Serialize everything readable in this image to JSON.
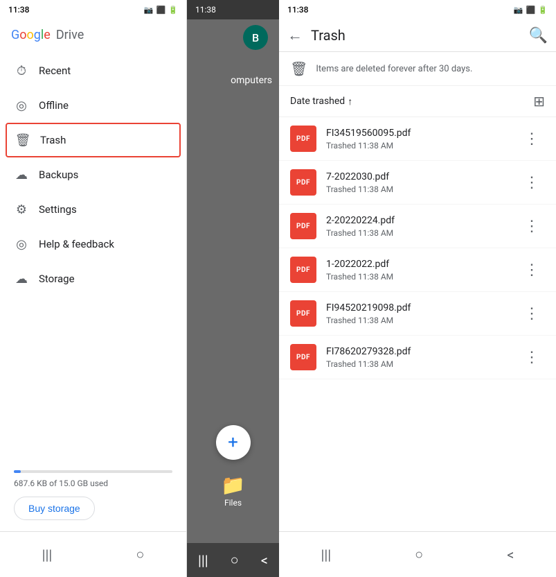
{
  "leftPanel": {
    "statusBar": {
      "time": "11:38"
    },
    "logo": {
      "google": "Google",
      "drive": "Drive"
    },
    "navItems": [
      {
        "id": "recent",
        "icon": "🕐",
        "label": "Recent",
        "active": false
      },
      {
        "id": "offline",
        "icon": "⊙",
        "label": "Offline",
        "active": false
      },
      {
        "id": "trash",
        "icon": "🗑",
        "label": "Trash",
        "active": true
      },
      {
        "id": "backups",
        "icon": "☁",
        "label": "Backups",
        "active": false
      },
      {
        "id": "settings",
        "icon": "⚙",
        "label": "Settings",
        "active": false
      },
      {
        "id": "help",
        "icon": "◎",
        "label": "Help & feedback",
        "active": false
      },
      {
        "id": "storage",
        "icon": "☁",
        "label": "Storage",
        "active": false
      }
    ],
    "storage": {
      "used": "687.6 KB of 15.0 GB used",
      "percentUsed": 4.58,
      "buyLabel": "Buy storage"
    },
    "bottomNav": [
      "|||",
      "○"
    ]
  },
  "middlePanel": {
    "statusBar": {
      "time": "11:38"
    },
    "avatar": "B",
    "label": "omputers",
    "fabPlus": "+",
    "filesLabel": "Files",
    "bottomNav": [
      "|||",
      "○",
      "<"
    ]
  },
  "rightPanel": {
    "statusBar": {
      "time": "11:38"
    },
    "header": {
      "title": "Trash",
      "backArrow": "←",
      "searchIcon": "🔍"
    },
    "notice": {
      "icon": "🗑",
      "text": "Items are deleted forever after 30 days."
    },
    "sort": {
      "label": "Date trashed",
      "arrow": "↑",
      "gridIcon": "⊞"
    },
    "files": [
      {
        "name": "FI34519560095.pdf",
        "meta": "Trashed 11:38 AM"
      },
      {
        "name": "7-2022030.pdf",
        "meta": "Trashed 11:38 AM"
      },
      {
        "name": "2-20220224.pdf",
        "meta": "Trashed 11:38 AM"
      },
      {
        "name": "1-2022022.pdf",
        "meta": "Trashed 11:38 AM"
      },
      {
        "name": "FI94520219098.pdf",
        "meta": "Trashed 11:38 AM"
      },
      {
        "name": "FI78620279328.pdf",
        "meta": "Trashed 11:38 AM"
      }
    ],
    "pdfLabel": "PDF",
    "moreIcon": "⋮",
    "bottomNav": [
      "|||",
      "○",
      "<"
    ]
  }
}
